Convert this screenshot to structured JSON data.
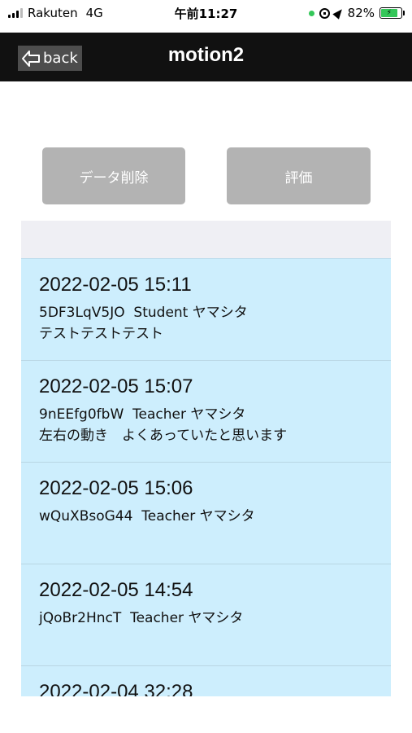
{
  "status_bar": {
    "carrier": "Rakuten",
    "network": "4G",
    "time": "午前11:27",
    "battery": "82%"
  },
  "nav": {
    "back_label": "back",
    "title": "motion2"
  },
  "actions": {
    "delete_label": "データ削除",
    "evaluate_label": "評価"
  },
  "records": [
    {
      "date": "2022-02-05 15:11",
      "id": "5DF3LqV5JO",
      "role": "Student",
      "name": "ヤマシタ",
      "comment": "テストテストテスト"
    },
    {
      "date": "2022-02-05 15:07",
      "id": "9nEEfg0fbW",
      "role": "Teacher",
      "name": "ヤマシタ",
      "comment": "左右の動き　よくあっていたと思います"
    },
    {
      "date": "2022-02-05 15:06",
      "id": "wQuXBsoG44",
      "role": "Teacher",
      "name": "ヤマシタ",
      "comment": ""
    },
    {
      "date": "2022-02-05 14:54",
      "id": "jQoBr2HncT",
      "role": "Teacher",
      "name": "ヤマシタ",
      "comment": ""
    },
    {
      "date": "2022-02-04 32:28",
      "id": "",
      "role": "",
      "name": "",
      "comment": ""
    }
  ]
}
